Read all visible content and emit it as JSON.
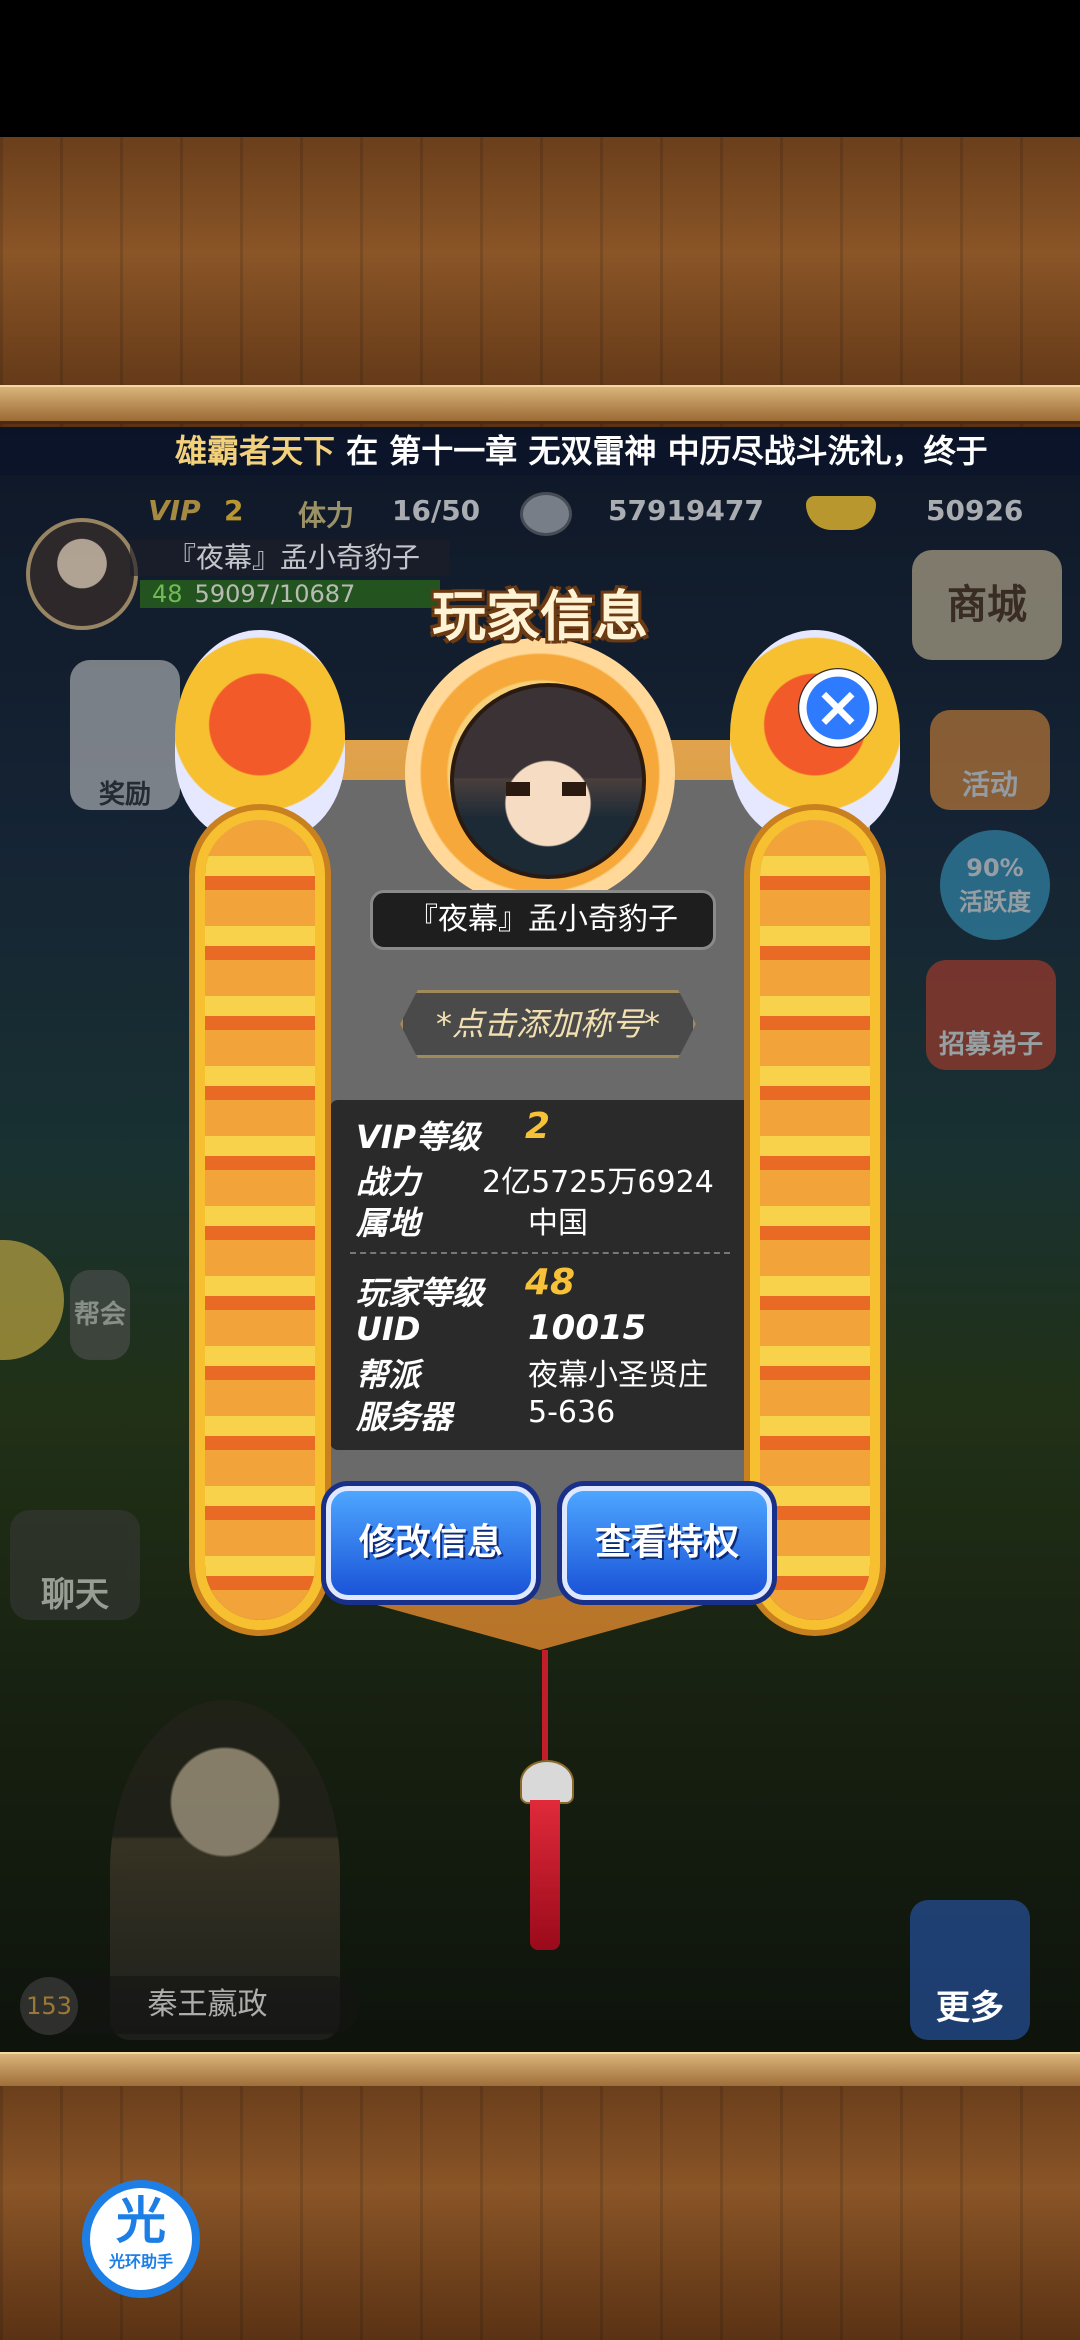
{
  "ticker": {
    "highlight": "雄霸者天下",
    "text": " 在 第十一章 无双雷神 中历尽战斗洗礼，终于"
  },
  "stats": {
    "vip": "VIP",
    "vip_level": "2",
    "stamina_label": "体力",
    "stamina": "16/50",
    "silver": "57919477",
    "gold": "50926"
  },
  "player_strip": {
    "name": "『夜幕』孟小奇豹子",
    "level": "48",
    "exp": "59097/10687"
  },
  "side": {
    "shop": "商城",
    "activity": "活动",
    "liveness_pct": "90%",
    "liveness": "活跃度",
    "recruit": "招募弟子",
    "chat": "聊天",
    "guild": "帮会",
    "rewards": "奖励"
  },
  "modal": {
    "title": "玩家信息",
    "player_name": "『夜幕』孟小奇豹子",
    "title_hint": "*点击添加称号*",
    "rows_a": [
      {
        "label": "VIP等级",
        "value": "2"
      },
      {
        "label": "战力",
        "value": "2亿5725万6924"
      },
      {
        "label": "属地",
        "value": "中国"
      }
    ],
    "rows_b": [
      {
        "label": "玩家等级",
        "value": "48"
      },
      {
        "label": "UID",
        "value": "10015"
      },
      {
        "label": "帮派",
        "value": "夜幕小圣贤庄"
      },
      {
        "label": "服务器",
        "value": "5-636"
      }
    ],
    "edit_button": "修改信息",
    "privilege_button": "查看特权",
    "close": "×"
  },
  "hero": {
    "level": "153",
    "name": "秦王嬴政"
  },
  "more": "更多",
  "helper": {
    "glyph": "光",
    "label": "光环助手"
  }
}
